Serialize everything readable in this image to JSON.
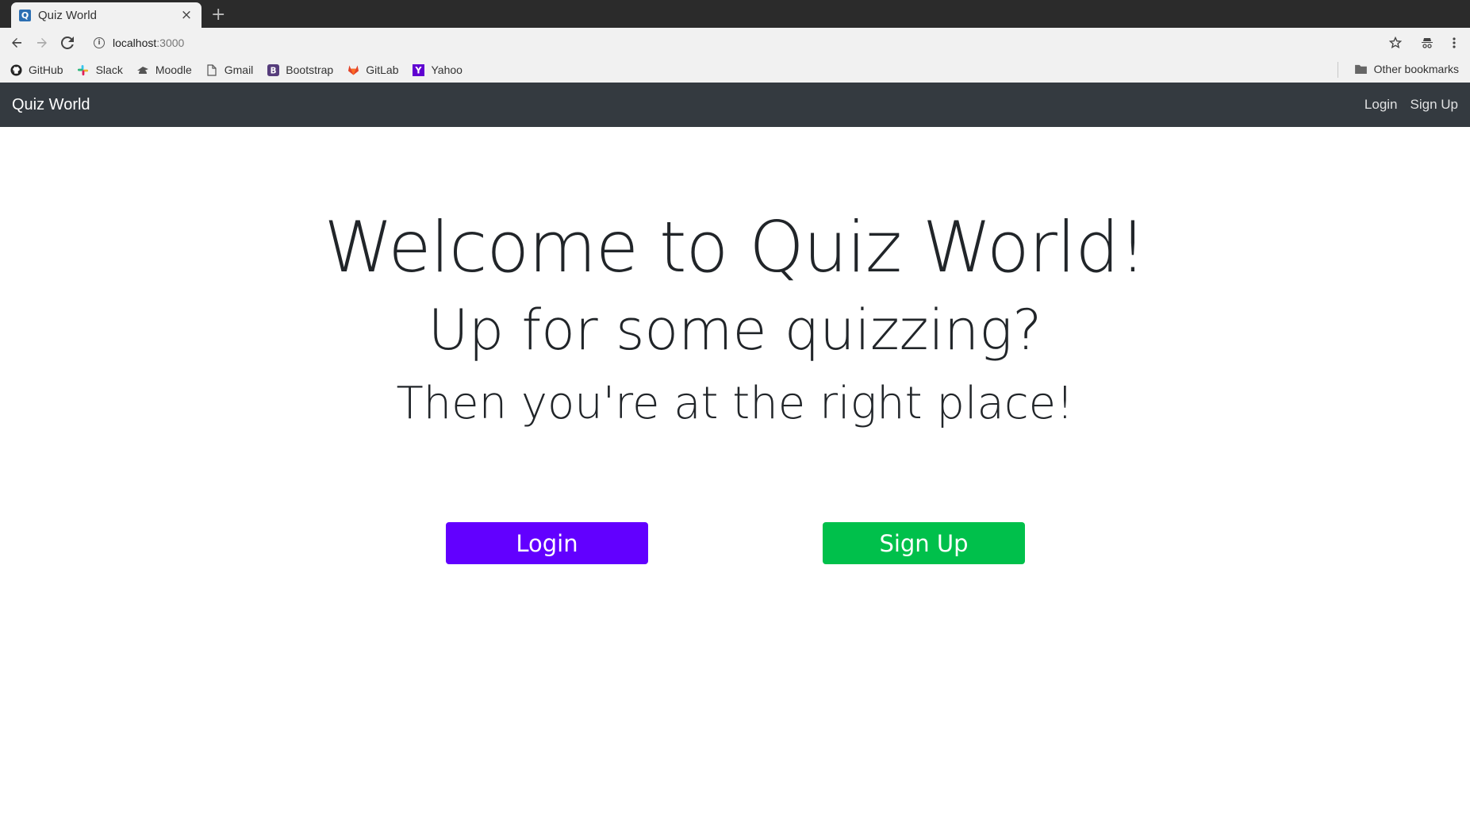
{
  "browser": {
    "tab_title": "Quiz World",
    "favicon_letter": "Q",
    "url_host": "localhost",
    "url_port": ":3000",
    "bookmarks": [
      {
        "label": "GitHub",
        "icon": "github-icon"
      },
      {
        "label": "Slack",
        "icon": "slack-icon"
      },
      {
        "label": "Moodle",
        "icon": "moodle-icon"
      },
      {
        "label": "Gmail",
        "icon": "page-icon"
      },
      {
        "label": "Bootstrap",
        "icon": "bootstrap-icon"
      },
      {
        "label": "GitLab",
        "icon": "gitlab-icon"
      },
      {
        "label": "Yahoo",
        "icon": "yahoo-icon"
      }
    ],
    "other_bookmarks": "Other bookmarks"
  },
  "navbar": {
    "brand": "Quiz World",
    "links": [
      "Login",
      "Sign Up"
    ],
    "background": "#343a40"
  },
  "hero": {
    "title": "Welcome to Quiz World!",
    "subtitle": "Up for some quizzing?",
    "tagline": "Then you're at the right place!"
  },
  "buttons": {
    "login": {
      "label": "Login",
      "color": "#6200ff"
    },
    "signup": {
      "label": "Sign Up",
      "color": "#00c04b"
    }
  }
}
